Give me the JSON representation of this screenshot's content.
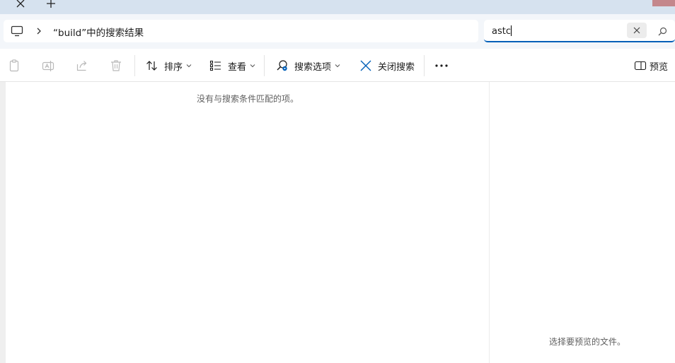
{
  "tabs": {
    "close_glyph": "✕",
    "new_tab_glyph": "+"
  },
  "address": {
    "breadcrumb": "“build”中的搜索结果",
    "device_icon": "monitor-icon",
    "separator_icon": "chevron-right-icon"
  },
  "search": {
    "value": "astc",
    "clear_icon": "close-icon",
    "search_icon": "search-icon"
  },
  "toolbar": {
    "copy_icon": "copy-icon",
    "rename_icon": "rename-icon",
    "share_icon": "share-icon",
    "delete_icon": "trash-icon",
    "sort_label": "排序",
    "view_label": "查看",
    "search_options_label": "搜索选项",
    "close_search_label": "关闭搜索",
    "more_icon": "more-icon",
    "preview_label": "预览"
  },
  "content": {
    "empty_message": "没有与搜索条件匹配的项。"
  },
  "preview_pane": {
    "message": "选择要预览的文件。"
  },
  "colors": {
    "accent": "#005fb8",
    "titlebar": "#d6e2ef",
    "address_row": "#f3f6fa",
    "window_close": "#c4878c"
  }
}
